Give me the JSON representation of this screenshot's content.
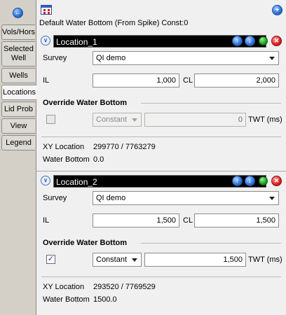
{
  "sidebar": {
    "tabs": [
      {
        "label": "Vols/Hors"
      },
      {
        "label": "Selected Well"
      },
      {
        "label": "Wells"
      },
      {
        "label": "Locations"
      },
      {
        "label": "Lid Prob"
      },
      {
        "label": "View"
      },
      {
        "label": "Legend"
      }
    ]
  },
  "header": {
    "default_water_bottom": "Default Water Bottom (From Spike)",
    "const_text": "Const:0"
  },
  "locations": [
    {
      "name": "Location_1",
      "survey_label": "Survey",
      "survey_value": "QI demo",
      "il_label": "IL",
      "il_value": "1,000",
      "cl_label": "CL",
      "cl_value": "2,000",
      "override_label": "Override Water Bottom",
      "override_checked": "",
      "mode_value": "Constant",
      "twt_value": "0",
      "twt_label": "TWT (ms)",
      "xy_label": "XY Location",
      "xy_value": "299770 / 7763279",
      "wb_label": "Water Bottom",
      "wb_value": "0.0"
    },
    {
      "name": "Location_2",
      "survey_label": "Survey",
      "survey_value": "QI demo",
      "il_label": "IL",
      "il_value": "1,500",
      "cl_label": "CL",
      "cl_value": "1,500",
      "override_label": "Override Water Bottom",
      "override_checked": "✓",
      "mode_value": "Constant",
      "twt_value": "1,500",
      "twt_label": "TWT (ms)",
      "xy_label": "XY Location",
      "xy_value": "293520 / 7769529",
      "wb_label": "Water Bottom",
      "wb_value": "1500.0"
    }
  ]
}
